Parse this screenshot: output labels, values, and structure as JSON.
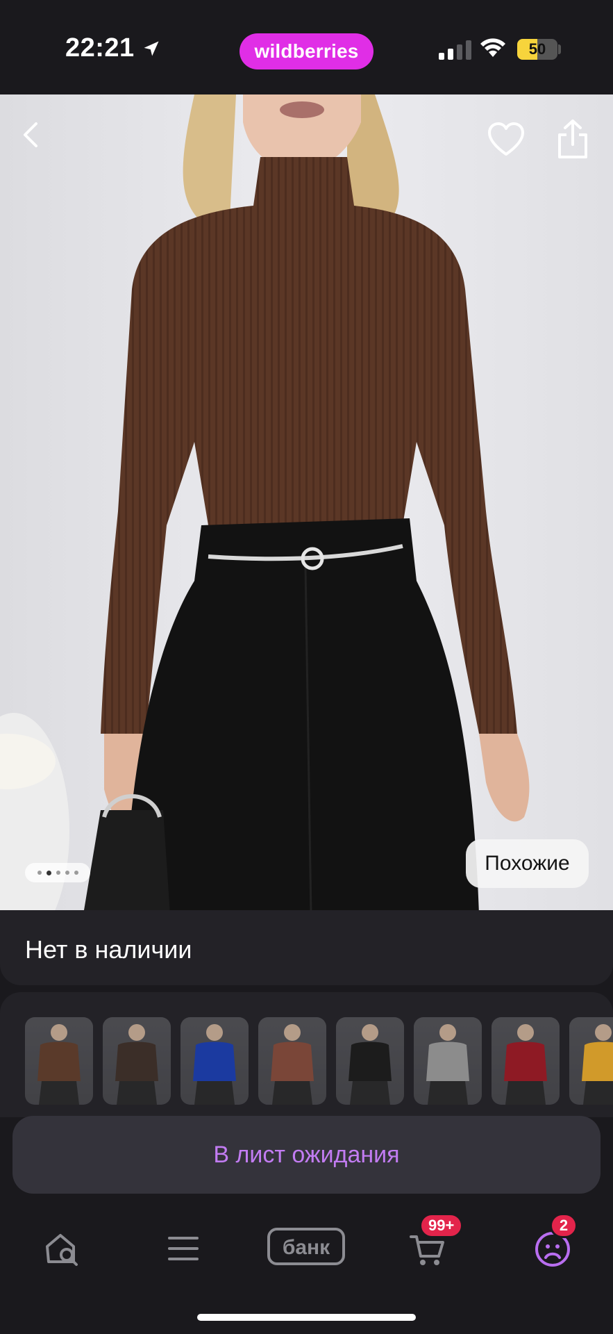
{
  "status_bar": {
    "time": "22:21",
    "brand": "wildberries",
    "battery_level": 50,
    "battery_label": "50"
  },
  "product": {
    "gallery_page_count": 5,
    "gallery_active_index": 1,
    "similar_label": "Похожие",
    "availability": "Нет в наличии",
    "variant_colors": [
      "#5a3a2a",
      "#3b2e28",
      "#1b3aa0",
      "#7a4638",
      "#1c1c1c",
      "#8c8c8c",
      "#8e1a24",
      "#d19a2a"
    ],
    "wait_list_label": "В лист ожидания"
  },
  "bottom_nav": {
    "items": [
      {
        "name": "search",
        "icon": "home-search-icon"
      },
      {
        "name": "catalog",
        "icon": "menu-icon"
      },
      {
        "name": "bank",
        "label": "банк"
      },
      {
        "name": "cart",
        "icon": "cart-icon",
        "badge": "99+"
      },
      {
        "name": "profile",
        "icon": "profile-icon",
        "badge": "2"
      }
    ]
  },
  "colors": {
    "brand": "#e02ee6",
    "accent_text": "#c27cf2",
    "badge": "#e3244b",
    "background": "#1a191d"
  }
}
